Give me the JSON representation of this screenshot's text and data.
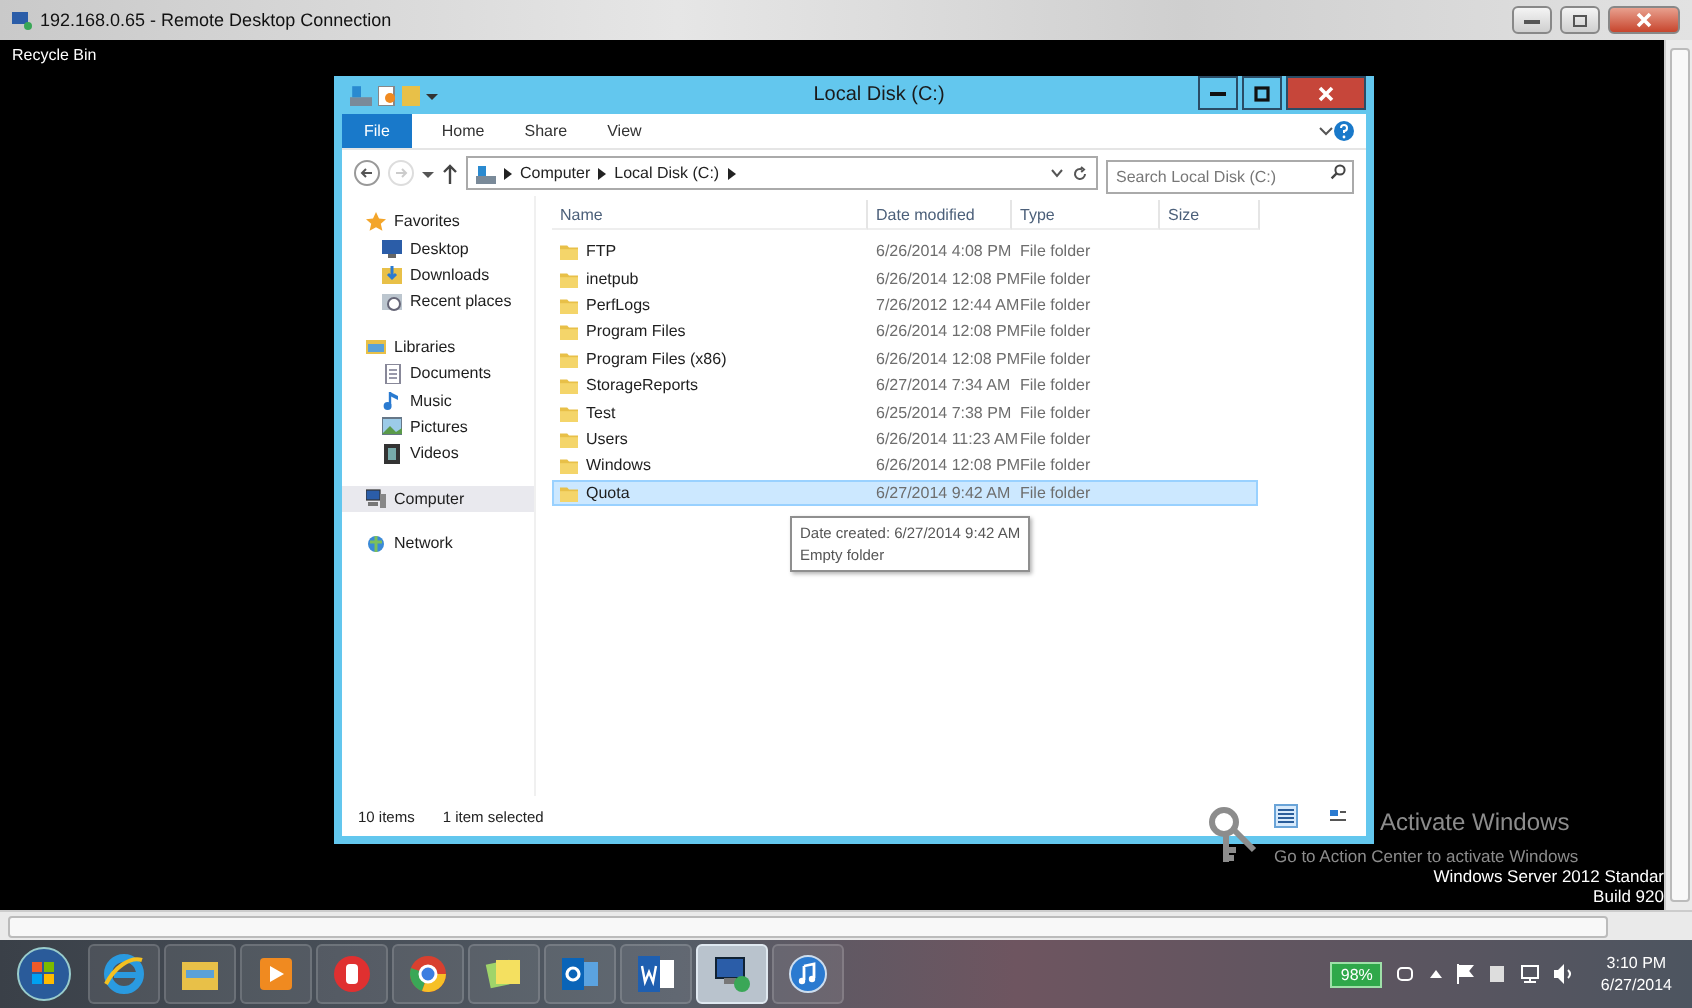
{
  "rdp_window": {
    "title": "192.168.0.65 - Remote Desktop Connection"
  },
  "desktop": {
    "icons": [
      {
        "label": "Recycle Bin"
      }
    ],
    "activation": {
      "title": "Activate Windows",
      "message": "Go to Action Center to activate Windows"
    },
    "edition": [
      "Windows Server 2012 Standar",
      "Build 920"
    ]
  },
  "explorer": {
    "title": "Local Disk (C:)",
    "ribbon_tabs": [
      {
        "label": "File",
        "kind": "menu"
      },
      {
        "label": "Home",
        "kind": "tab"
      },
      {
        "label": "Share",
        "kind": "tab"
      },
      {
        "label": "View",
        "kind": "tab"
      }
    ],
    "breadcrumb": [
      "Computer",
      "Local Disk (C:)"
    ],
    "search": {
      "placeholder": "Search Local Disk (C:)"
    },
    "nav": [
      {
        "label": "Favorites",
        "kind": "star",
        "selected": false,
        "children": [
          {
            "label": "Desktop",
            "kind": "desktop",
            "selected": false
          },
          {
            "label": "Downloads",
            "kind": "downloads",
            "selected": false
          },
          {
            "label": "Recent places",
            "kind": "recent",
            "selected": false
          }
        ]
      },
      {
        "label": "Libraries",
        "kind": "library",
        "selected": false,
        "children": [
          {
            "label": "Documents",
            "kind": "documents",
            "selected": false
          },
          {
            "label": "Music",
            "kind": "music",
            "selected": false
          },
          {
            "label": "Pictures",
            "kind": "pictures",
            "selected": false
          },
          {
            "label": "Videos",
            "kind": "videos",
            "selected": false
          }
        ]
      },
      {
        "label": "Computer",
        "kind": "computer",
        "selected": true
      },
      {
        "label": "Network",
        "kind": "network",
        "selected": false
      }
    ],
    "columns": [
      "Name",
      "Date modified",
      "Type",
      "Size"
    ],
    "rows": [
      {
        "name": "FTP",
        "date": "6/26/2014 4:08 PM",
        "type": "File folder",
        "selected": false
      },
      {
        "name": "inetpub",
        "date": "6/26/2014 12:08 PM",
        "type": "File folder",
        "selected": false
      },
      {
        "name": "PerfLogs",
        "date": "7/26/2012 12:44 AM",
        "type": "File folder",
        "selected": false
      },
      {
        "name": "Program Files",
        "date": "6/26/2014 12:08 PM",
        "type": "File folder",
        "selected": false
      },
      {
        "name": "Program Files (x86)",
        "date": "6/26/2014 12:08 PM",
        "type": "File folder",
        "selected": false
      },
      {
        "name": "StorageReports",
        "date": "6/27/2014 7:34 AM",
        "type": "File folder",
        "selected": false
      },
      {
        "name": "Test",
        "date": "6/25/2014 7:38 PM",
        "type": "File folder",
        "selected": false
      },
      {
        "name": "Users",
        "date": "6/26/2014 11:23 AM",
        "type": "File folder",
        "selected": false
      },
      {
        "name": "Windows",
        "date": "6/26/2014 12:08 PM",
        "type": "File folder",
        "selected": false
      },
      {
        "name": "Quota",
        "date": "6/27/2014 9:42 AM",
        "type": "File folder",
        "selected": true
      }
    ],
    "tooltip": [
      "Date created: 6/27/2014 9:42 AM",
      "Empty folder"
    ],
    "status": [
      "10 items",
      "1 item selected"
    ]
  },
  "taskbar": {
    "apps": [
      {
        "kind": "ie",
        "selected": false
      },
      {
        "kind": "explorer",
        "selected": false
      },
      {
        "kind": "media",
        "selected": false
      },
      {
        "kind": "red",
        "selected": false
      },
      {
        "kind": "chrome",
        "selected": false
      },
      {
        "kind": "notes",
        "selected": false
      },
      {
        "kind": "outlook",
        "selected": false
      },
      {
        "kind": "word",
        "selected": false
      },
      {
        "kind": "rdp",
        "selected": true
      },
      {
        "kind": "itunes",
        "selected": false
      }
    ],
    "battery": "98%",
    "time": "3:10 PM",
    "date": "6/27/2014"
  }
}
